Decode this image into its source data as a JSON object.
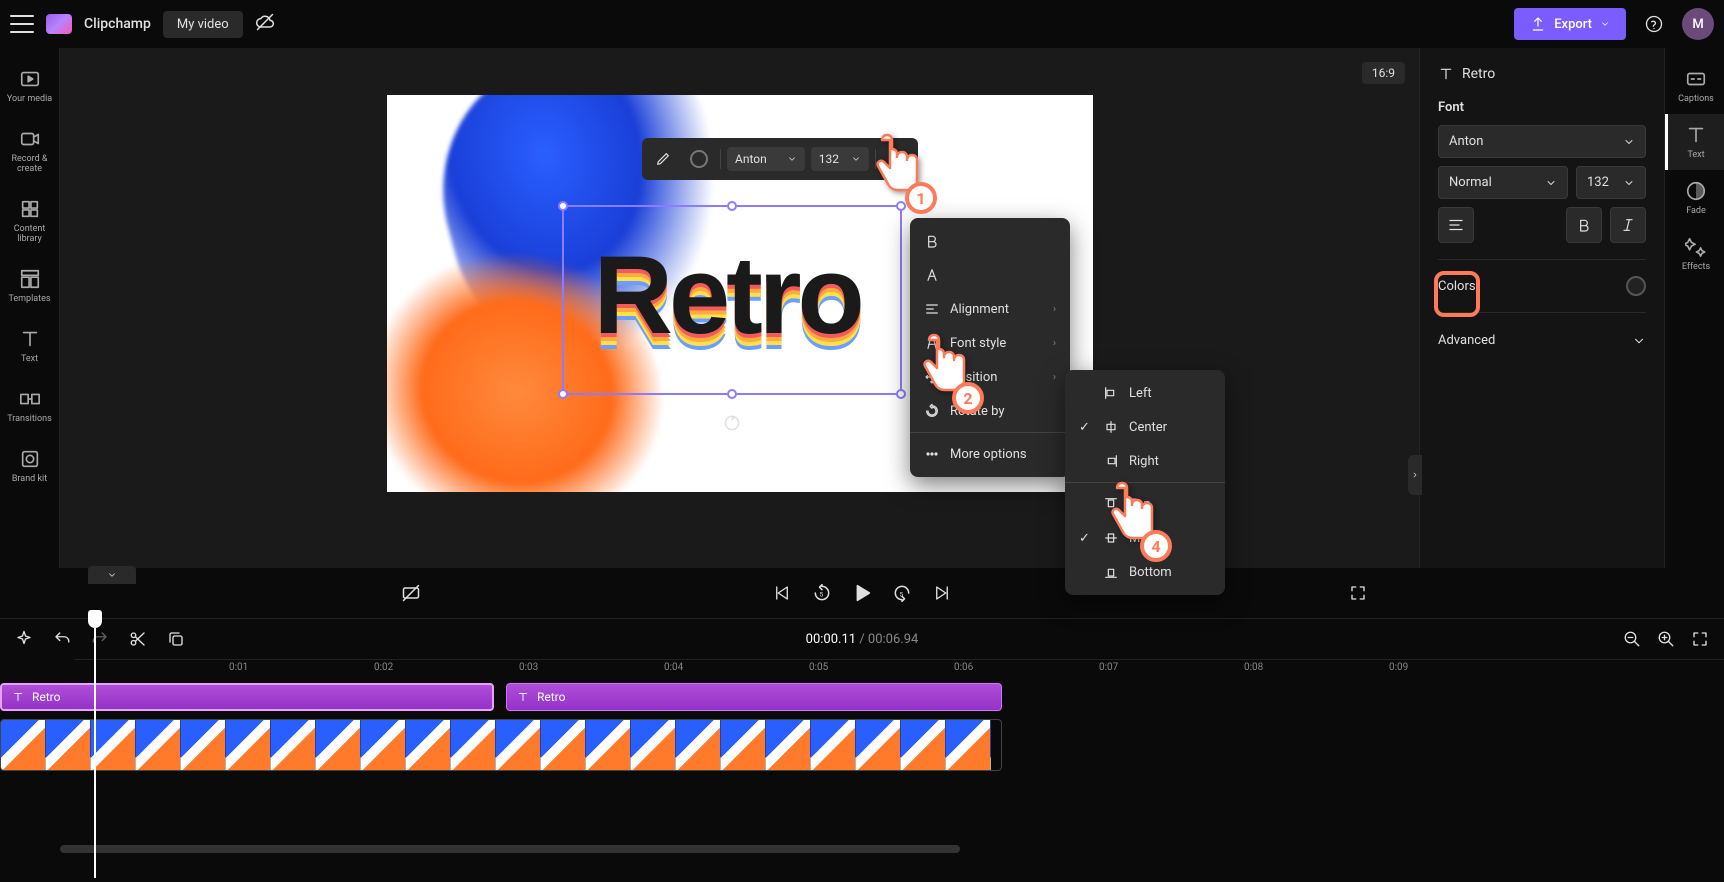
{
  "app": {
    "name": "Clipchamp",
    "video_title": "My video"
  },
  "export": {
    "label": "Export"
  },
  "avatar": {
    "initial": "M"
  },
  "aspect": {
    "label": "16:9"
  },
  "canvas": {
    "text": "Retro"
  },
  "float_toolbar": {
    "font": "Anton",
    "size": "132"
  },
  "context_menu": {
    "items": [
      "B",
      "A",
      "Alignment",
      "Font style",
      "Position",
      "Rotate by",
      "More options"
    ]
  },
  "submenu": {
    "left": "Left",
    "center": "Center",
    "right": "Right",
    "top": "Top",
    "middle": "Middle",
    "bottom": "Bottom"
  },
  "left_nav": {
    "your_media": "Your media",
    "record": "Record & create",
    "content": "Content library",
    "templates": "Templates",
    "text": "Text",
    "transitions": "Transitions",
    "brand": "Brand kit"
  },
  "right_nav": {
    "captions": "Captions",
    "text": "Text",
    "fade": "Fade",
    "effects": "Effects"
  },
  "panel": {
    "title": "Retro",
    "font_label": "Font",
    "font_value": "Anton",
    "weight_value": "Normal",
    "size_value": "132",
    "colors_label": "Colors",
    "advanced_label": "Advanced"
  },
  "playback": {
    "current": "00:00.11",
    "sep": "/",
    "duration": "00:06.94"
  },
  "ruler": [
    "0:01",
    "0:02",
    "0:03",
    "0:04",
    "0:05",
    "0:06",
    "0:07",
    "0:08",
    "0:09"
  ],
  "clips": {
    "text1": "Retro",
    "text2": "Retro"
  },
  "callouts": {
    "n1": "1",
    "n2": "2",
    "n4": "4"
  }
}
